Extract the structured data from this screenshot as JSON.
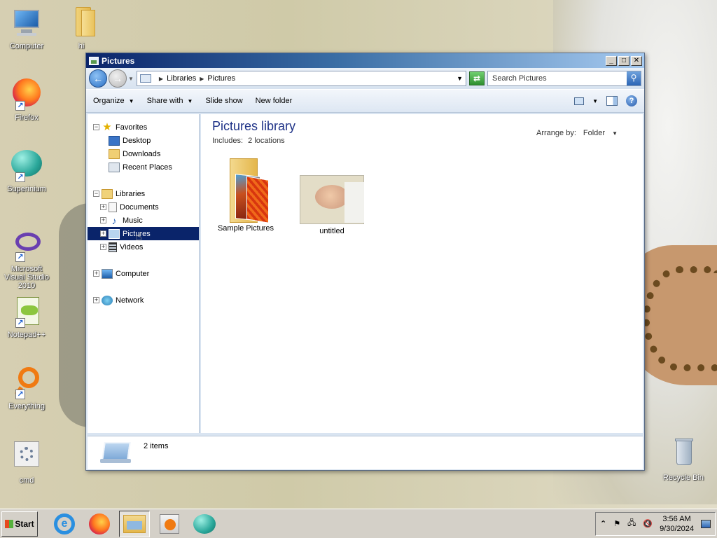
{
  "desktop": {
    "icons": [
      {
        "label": "Computer"
      },
      {
        "label": "hi"
      },
      {
        "label": "Firefox"
      },
      {
        "label": "Superinium"
      },
      {
        "label": "Microsoft Visual Studio 2010"
      },
      {
        "label": "Notepad++"
      },
      {
        "label": "Everything"
      },
      {
        "label": "cmd"
      },
      {
        "label": "Recycle Bin"
      }
    ]
  },
  "window": {
    "title": "Pictures",
    "address": {
      "crumbs": [
        "Libraries",
        "Pictures"
      ]
    },
    "search": {
      "placeholder": "Search Pictures"
    },
    "toolbar": {
      "organize": "Organize",
      "share_with": "Share with",
      "slide_show": "Slide show",
      "new_folder": "New folder"
    },
    "nav": {
      "favorites": "Favorites",
      "favorites_items": [
        "Desktop",
        "Downloads",
        "Recent Places"
      ],
      "libraries": "Libraries",
      "libraries_items": [
        "Documents",
        "Music",
        "Pictures",
        "Videos"
      ],
      "computer": "Computer",
      "network": "Network"
    },
    "content": {
      "title": "Pictures library",
      "includes_label": "Includes:",
      "includes_value": "2 locations",
      "arrange_label": "Arrange by:",
      "arrange_value": "Folder",
      "items": [
        "Sample Pictures",
        "untitled"
      ]
    },
    "status": {
      "count": "2 items"
    }
  },
  "taskbar": {
    "start_label": "Start",
    "clock": {
      "time": "3:56 AM",
      "date": "9/30/2024"
    }
  }
}
